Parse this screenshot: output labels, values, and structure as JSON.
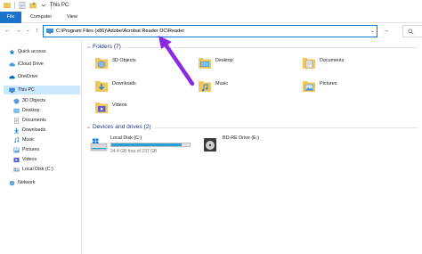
{
  "window": {
    "title": "This PC"
  },
  "ribbon": {
    "tabs": [
      "File",
      "Computer",
      "View"
    ]
  },
  "address": {
    "path": "C:\\Program Files (x86)\\Adobe\\Acrobat Reader DC\\Reader"
  },
  "nav_pane": {
    "items": [
      {
        "label": "Quick access",
        "icon": "star-icon"
      },
      {
        "label": "iCloud Drive",
        "icon": "cloud-icon"
      },
      {
        "label": "OneDrive",
        "icon": "cloud-icon"
      },
      {
        "label": "This PC",
        "icon": "computer-icon"
      },
      {
        "label": "3D Objects",
        "icon": "cube-icon"
      },
      {
        "label": "Desktop",
        "icon": "desktop-folder-icon"
      },
      {
        "label": "Documents",
        "icon": "document-icon"
      },
      {
        "label": "Downloads",
        "icon": "download-icon"
      },
      {
        "label": "Music",
        "icon": "music-icon"
      },
      {
        "label": "Pictures",
        "icon": "picture-icon"
      },
      {
        "label": "Videos",
        "icon": "video-icon"
      },
      {
        "label": "Local Disk (C:)",
        "icon": "drive-icon"
      },
      {
        "label": "Network",
        "icon": "network-icon"
      }
    ]
  },
  "folders_group": {
    "header": "Folders (7)",
    "items": [
      {
        "label": "3D Objects",
        "icon": "cube-folder-icon"
      },
      {
        "label": "Desktop",
        "icon": "desktop-folder-icon"
      },
      {
        "label": "Documents",
        "icon": "documents-folder-icon"
      },
      {
        "label": "Downloads",
        "icon": "downloads-folder-icon"
      },
      {
        "label": "Music",
        "icon": "music-folder-icon"
      },
      {
        "label": "Pictures",
        "icon": "pictures-folder-icon"
      },
      {
        "label": "Videos",
        "icon": "videos-folder-icon"
      }
    ]
  },
  "drives_group": {
    "header": "Devices and drives (2)",
    "drives": [
      {
        "label": "Local Disk (C:)",
        "free_text": "24.4 GB free of 237 GB",
        "used_fraction": 0.9
      },
      {
        "label": "BD-RE Drive (E:)"
      }
    ]
  },
  "colors": {
    "accent": "#0078d7",
    "file_tab": "#1a73c9",
    "group_header": "#1e3287",
    "pointer": "#8a2be2",
    "drive_bar": "#26a0da"
  }
}
